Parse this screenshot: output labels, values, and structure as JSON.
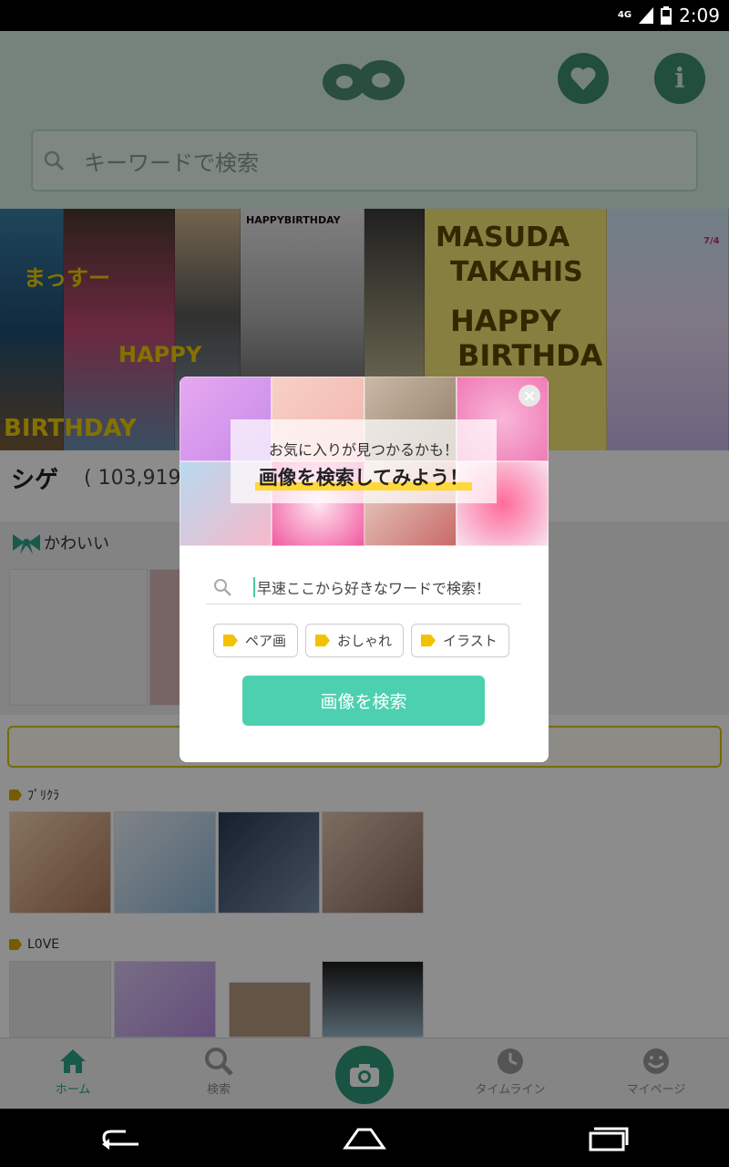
{
  "status_bar": {
    "time": "2:09",
    "network": "4G"
  },
  "header": {
    "search_placeholder": "キーワードで検索",
    "icons": [
      "app-logo",
      "heart-icon",
      "info-icon"
    ]
  },
  "banner": {
    "texts": [
      "HAPPYBIRTHDAY",
      "MASUDA",
      "TAKAHIS",
      "HAPPY",
      "BIRTHDA",
      "HAPPY",
      "BIRTHDAY",
      "まっすー",
      "7/4"
    ]
  },
  "main": {
    "title": "シゲ",
    "count": "( 103,919",
    "section_label": "かわいい",
    "rows": [
      {
        "label": "ﾌﾟﾘｸﾗ"
      },
      {
        "label": "L0VE"
      }
    ]
  },
  "bottom_nav": {
    "items": [
      {
        "label": "ホーム",
        "icon": "home-icon",
        "active": true
      },
      {
        "label": "検索",
        "icon": "search-icon"
      },
      {
        "label": "",
        "icon": "camera-icon"
      },
      {
        "label": "タイムライン",
        "icon": "clock-icon"
      },
      {
        "label": "マイページ",
        "icon": "smiley-icon"
      }
    ]
  },
  "dialog": {
    "subtitle": "お気に入りが見つかるかも！",
    "title": "画像を検索してみよう！",
    "input_placeholder": "早速ここから好きなワードで検索！",
    "chips": [
      "ペア画",
      "おしゃれ",
      "イラスト"
    ],
    "search_button": "画像を検索",
    "close_icon": "close-icon"
  },
  "colors": {
    "accent": "#4dd0b0",
    "header_bg": "#d7efe3",
    "tag_yellow": "#f2c200"
  }
}
